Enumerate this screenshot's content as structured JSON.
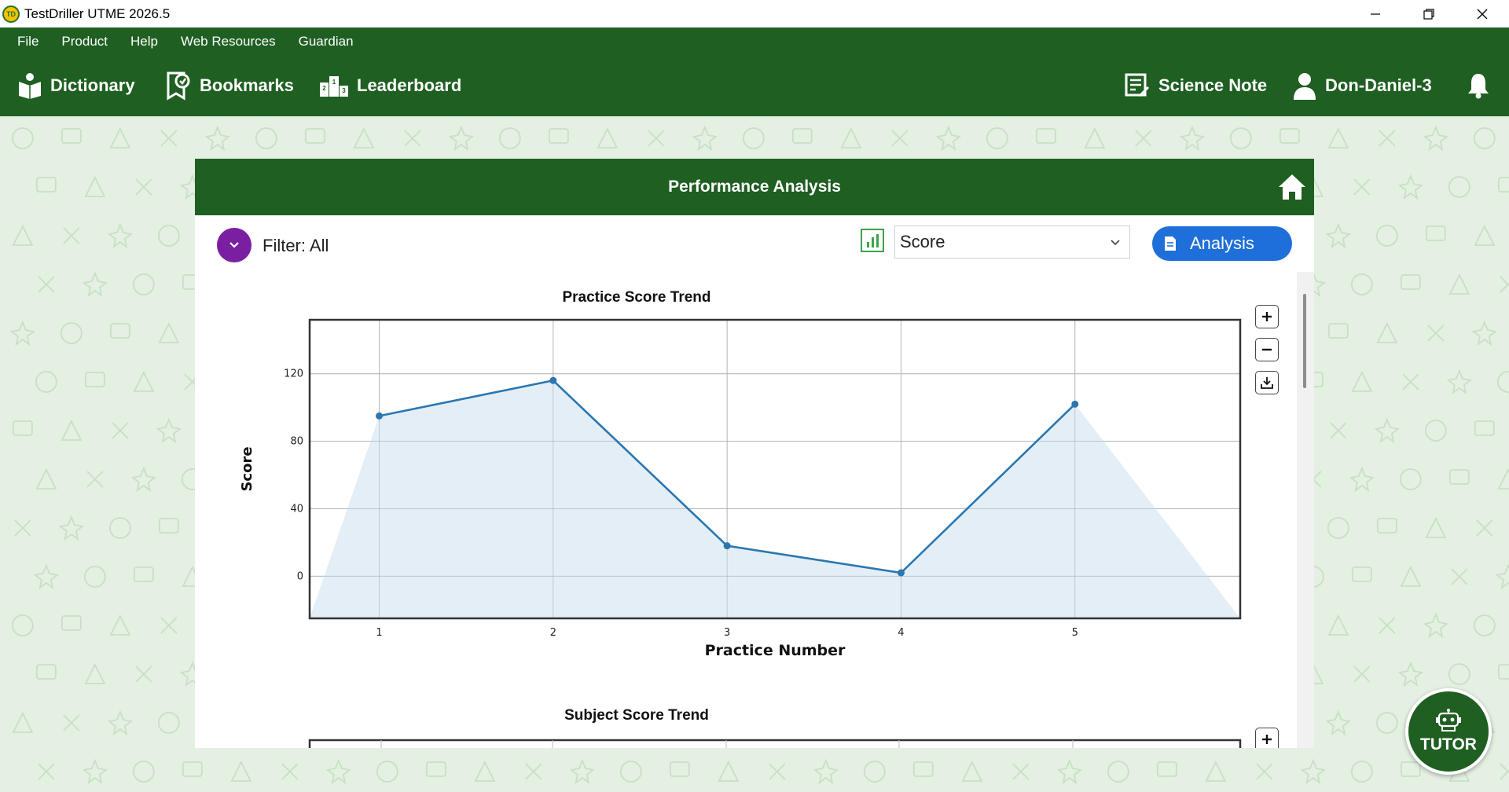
{
  "window": {
    "title": "TestDriller UTME 2026.5",
    "logo_text": "TD"
  },
  "menu": [
    "File",
    "Product",
    "Help",
    "Web Resources",
    "Guardian"
  ],
  "toolbar": {
    "dictionary": "Dictionary",
    "bookmarks": "Bookmarks",
    "leaderboard": "Leaderboard",
    "science_note": "Science Note",
    "user": "Don-Daniel-3"
  },
  "panel": {
    "title": "Performance Analysis",
    "filter_label": "Filter: All",
    "metric_selected": "Score",
    "analysis_label": "Analysis"
  },
  "second_chart_title": "Subject Score Trend",
  "tutor_label": "TUTOR",
  "colors": {
    "brand_green": "#1f5f22",
    "filter_purple": "#7b1fa2",
    "analysis_blue": "#1e6fd9",
    "line": "#2a77b0",
    "fill": "#deebf5"
  },
  "chart_data": {
    "type": "line",
    "title": "Practice Score Trend",
    "xlabel": "Practice Number",
    "ylabel": "Score",
    "x": [
      1,
      2,
      3,
      4,
      5
    ],
    "values": [
      95,
      116,
      18,
      2,
      102
    ],
    "xlim": [
      0.6,
      5.95
    ],
    "ylim": [
      -25,
      152
    ],
    "yticks": [
      0,
      40,
      80,
      120
    ],
    "xticks": [
      1,
      2,
      3,
      4,
      5
    ],
    "grid": true,
    "legend": "none"
  }
}
